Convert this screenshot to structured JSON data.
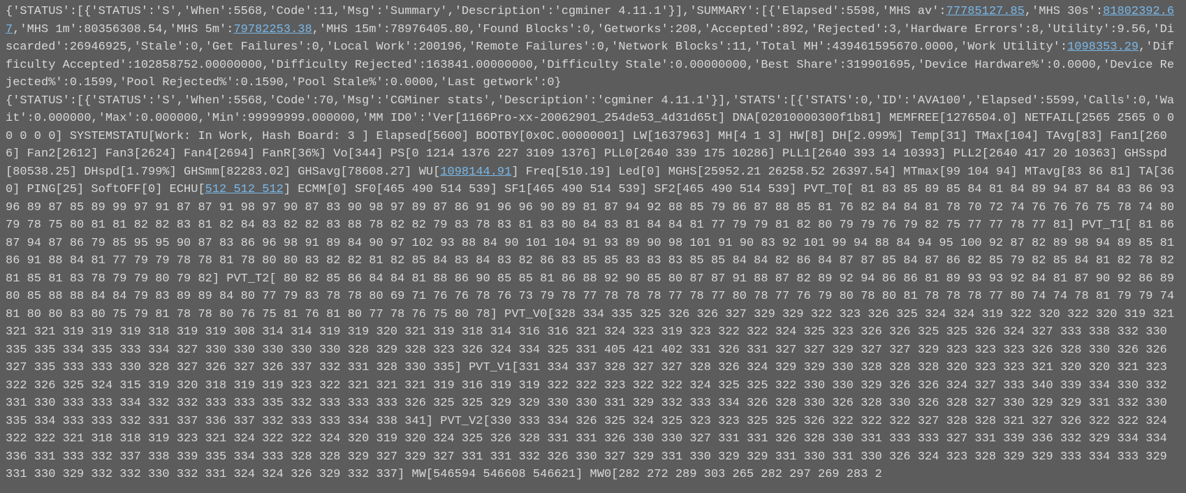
{
  "summary": {
    "status": {
      "STATUS": "S",
      "When": 5568,
      "Code": 11,
      "Msg": "Summary",
      "Description": "cgminer 4.11.1"
    },
    "data": {
      "Elapsed": 5598,
      "MHS_av": "77785127.85",
      "MHS_30s": "81802392.67",
      "MHS_1m": "80356308.54",
      "MHS_5m": "79782253.38",
      "MHS_15m": "78976405.80",
      "Found_Blocks": 0,
      "Getworks": 208,
      "Accepted": 892,
      "Rejected": 3,
      "Hardware_Errors": 8,
      "Utility": "9.56",
      "Discarded": 26946925,
      "Stale": 0,
      "Get_Failures": 0,
      "Local_Work": 200196,
      "Remote_Failures": 0,
      "Network_Blocks": 11,
      "Total_MH": "439461595670.0000",
      "Work_Utility": "1098353.29",
      "Difficulty_Accepted": "102858752.00000000",
      "Difficulty_Rejected": "163841.00000000",
      "Difficulty_Stale": "0.00000000",
      "Best_Share": 319901695,
      "Device_Hardware_pct": "0.0000",
      "Device_Rejected_pct": "0.1599",
      "Pool_Rejected_pct": "0.1590",
      "Pool_Stale_pct": "0.0000",
      "Last_getwork": 0
    }
  },
  "stats": {
    "status": {
      "STATUS": "S",
      "When": 5568,
      "Code": 70,
      "Msg": "CGMiner stats",
      "Description": "cgminer 4.11.1"
    },
    "data": {
      "STATS": 0,
      "ID": "AVA100",
      "Elapsed": 5599,
      "Calls": 0,
      "Wait": "0.000000",
      "Max": "0.000000",
      "Min": "99999999.000000",
      "MM_ID0": {
        "Ver": "1166Pro-xx-20062901_254de53_4d31d65t",
        "DNA": "02010000300f1b81",
        "MEMFREE": "1276504.0",
        "NETFAIL": "2565 2565 0 0 0 0 0 0",
        "SYSTEMSTATU": "Work: In Work, Hash Board: 3 ",
        "Elapsed": "5600",
        "BOOTBY": "0x0C.00000001",
        "LW": "1637963",
        "MH": "4 1 3",
        "HW": "8",
        "DH": "2.099%",
        "Temp": "31",
        "TMax": "104",
        "TAvg": "83",
        "Fan1": "2606",
        "Fan2": "2612",
        "Fan3": "2624",
        "Fan4": "2694",
        "FanR": "36%",
        "Vo": "344",
        "PS": "0 1214 1376 227 3109 1376",
        "PLL0": "2640 339 175 10286",
        "PLL1": "2640 393 14 10393",
        "PLL2": "2640 417 20 10363",
        "GHSspd": "80538.25",
        "DHspd": "1.799%",
        "GHSmm": "82283.02",
        "GHSavg": "78608.27",
        "WU": "1098144.91",
        "Freq": "510.19",
        "Led": "0",
        "MGHS": "25952.21 26258.52 26397.54",
        "MTmax": "99 104 94",
        "MTavg": "83 86 81",
        "TA": "360",
        "PING": "25",
        "SoftOFF": "0",
        "ECHU": "512 512 512",
        "ECMM": "0",
        "SF0": "465 490 514 539",
        "SF1": "465 490 514 539",
        "SF2": "465 490 514 539",
        "PVT_T0": " 81 83 85 89 85 84 81 84 89 94 87 84 83 86 93 96 89 87 85 89 99 97 91 87 87 91 98 97 90 87 83 90 98 97 89 87 86 91 96 96 90 89 81 87 94 92 88 85 79 86 87 88 85 81 76 82 84 84 81 78 70 72 74 76 76 76 75 78 74 80 79 78 75 80 81 81 82 82 83 81 82 84 83 82 82 83 88 78 82 82 79 83 78 83 81 83 80 84 83 81 84 84 81 77 79 79 81 82 80 79 79 76 79 82 75 77 77 78 77 81",
        "PVT_T1": " 81 86 87 94 87 86 79 85 95 95 90 87 83 86 96 98 91 89 84 90 97 102 93 88 84 90 101 104 91 93 89 90 98 101 91 90 83 92 101 99 94 88 84 94 95 100 92 87 82 89 98 94 89 85 81 86 91 88 84 81 77 79 79 78 78 81 78 80 80 83 82 82 81 82 85 84 83 84 83 82 86 83 85 85 83 83 83 85 85 84 84 82 86 84 87 87 85 84 87 86 82 85 79 82 85 84 81 82 78 82 81 85 81 83 78 79 79 80 79 82",
        "PVT_T2": " 80 82 85 86 84 84 81 88 86 90 85 85 81 86 88 92 90 85 80 87 87 91 88 87 82 89 92 94 86 86 81 89 93 93 92 84 81 87 90 92 86 89 80 85 88 88 84 84 79 83 89 89 84 80 77 79 83 78 78 80 69 71 76 76 78 76 73 79 78 77 78 78 78 77 78 77 80 78 77 76 79 80 78 80 81 78 78 78 77 80 74 74 78 81 79 79 74 81 80 80 83 80 75 79 81 78 78 80 76 75 81 76 81 80 77 78 76 75 80 78",
        "PVT_V0": "328 334 335 325 326 326 327 329 329 322 323 326 325 324 324 319 322 320 322 320 319 321 321 321 319 319 319 318 319 319 308 314 314 319 319 320 321 319 318 314 316 316 321 324 323 319 323 322 322 324 325 323 326 326 325 325 326 324 327 333 338 332 330 335 335 334 335 333 334 327 330 330 330 330 330 328 329 328 323 326 324 334 325 331 405 421 402 331 326 331 327 327 329 327 327 329 323 323 323 326 328 330 326 326 327 335 333 333 330 328 327 326 327 326 337 332 331 328 330 335",
        "PVT_V1": "331 334 337 328 327 327 328 326 324 329 329 330 328 328 328 320 323 323 321 320 320 321 323 322 326 325 324 315 319 320 318 319 319 323 322 321 321 321 319 316 319 319 322 322 323 322 322 324 325 325 322 330 330 329 326 326 324 327 333 340 339 334 330 332 331 330 333 333 334 332 332 333 333 335 332 333 333 333 326 325 325 329 329 330 330 331 329 332 333 334 326 328 330 326 328 330 326 328 327 330 329 329 331 332 330 335 334 333 333 332 331 337 336 337 332 333 333 334 338 341",
        "PVT_V2": "330 333 334 326 325 324 325 323 323 325 325 326 322 322 322 327 328 328 321 327 326 322 322 324 322 322 321 318 318 319 323 321 324 322 322 324 320 319 320 324 325 326 328 331 331 326 330 330 327 331 331 326 328 330 331 333 333 327 331 339 336 332 329 334 334 336 331 333 332 337 338 339 335 334 333 328 328 329 327 329 327 331 331 332 326 330 327 329 331 330 329 329 331 330 331 330 326 324 323 328 329 329 333 334 333 329 331 330 329 332 332 330 332 331 324 324 326 329 332 337",
        "MW": "546594 546608 546621",
        "MW0_partial": "282 272 289 303 265 282 297 269 283 2"
      }
    }
  },
  "text": {
    "s0": "{'STATUS':[{'STATUS':'S','When':5568,'Code':11,'Msg':'Summary','Description':'cgminer 4.11.1'}],'SUMMARY':[{'Elapsed':5598,'MHS av':",
    "s1": ",'MHS 30s':",
    "s2": ",'MHS 1m':80356308.54,'MHS 5m':",
    "s3": ",'MHS 15m':78976405.80,'Found Blocks':0,'Getworks':208,'Accepted':892,'Rejected':3,'Hardware Errors':8,'Utility':9.56,'Discarded':26946925,'Stale':0,'Get Failures':0,'Local Work':200196,'Remote Failures':0,'Network Blocks':11,'Total MH':439461595670.0000,'Work Utility':",
    "s4": ",'Difficulty Accepted':102858752.00000000,'Difficulty Rejected':163841.00000000,'Difficulty Stale':0.00000000,'Best Share':319901695,'Device Hardware%':0.0000,'Device Rejected%':0.1599,'Pool Rejected%':0.1590,'Pool Stale%':0.0000,'Last getwork':0}",
    "s5": "{'STATUS':[{'STATUS':'S','When':5568,'Code':70,'Msg':'CGMiner stats','Description':'cgminer 4.11.1'}],'STATS':[{'STATS':0,'ID':'AVA100','Elapsed':5599,'Calls':0,'Wait':0.000000,'Max':0.000000,'Min':99999999.000000,'MM ID0':'Ver[1166Pro-xx-20062901_254de53_4d31d65t] DNA[02010000300f1b81] MEMFREE[1276504.0] NETFAIL[2565 2565 0 0 0 0 0 0] SYSTEMSTATU[Work: In Work, Hash Board: 3 ] Elapsed[5600] BOOTBY[0x0C.00000001] LW[1637963] MH[4 1 3] HW[8] DH[2.099%] Temp[31] TMax[104] TAvg[83] Fan1[2606] Fan2[2612] Fan3[2624] Fan4[2694] FanR[36%] Vo[344] PS[0 1214 1376 227 3109 1376] PLL0[2640 339 175 10286] PLL1[2640 393 14 10393] PLL2[2640 417 20 10363] GHSspd[80538.25] DHspd[1.799%] GHSmm[82283.02] GHSavg[78608.27] WU[",
    "s6": "] Freq[510.19] Led[0] MGHS[25952.21 26258.52 26397.54] MTmax[99 104 94] MTavg[83 86 81] TA[360] PING[25] SoftOFF[0] ECHU[",
    "s7": "] ECMM[0] SF0[465 490 514 539] SF1[465 490 514 539] SF2[465 490 514 539] PVT_T0[ 81 83 85 89 85 84 81 84 89 94 87 84 83 86 93 96 89 87 85 89 99 97 91 87 87 91 98 97 90 87 83 90 98 97 89 87 86 91 96 96 90 89 81 87 94 92 88 85 79 86 87 88 85 81 76 82 84 84 81 78 70 72 74 76 76 76 75 78 74 80 79 78 75 80 81 81 82 82 83 81 82 84 83 82 82 83 88 78 82 82 79 83 78 83 81 83 80 84 83 81 84 84 81 77 79 79 81 82 80 79 79 76 79 82 75 77 77 78 77 81] PVT_T1[ 81 86 87 94 87 86 79 85 95 95 90 87 83 86 96 98 91 89 84 90 97 102 93 88 84 90 101 104 91 93 89 90 98 101 91 90 83 92 101 99 94 88 84 94 95 100 92 87 82 89 98 94 89 85 81 86 91 88 84 81 77 79 79 78 78 81 78 80 80 83 82 82 81 82 85 84 83 84 83 82 86 83 85 85 83 83 83 85 85 84 84 82 86 84 87 87 85 84 87 86 82 85 79 82 85 84 81 82 78 82 81 85 81 83 78 79 79 80 79 82] PVT_T2[ 80 82 85 86 84 84 81 88 86 90 85 85 81 86 88 92 90 85 80 87 87 91 88 87 82 89 92 94 86 86 81 89 93 93 92 84 81 87 90 92 86 89 80 85 88 88 84 84 79 83 89 89 84 80 77 79 83 78 78 80 69 71 76 76 78 76 73 79 78 77 78 78 78 77 78 77 80 78 77 76 79 80 78 80 81 78 78 78 77 80 74 74 78 81 79 79 74 81 80 80 83 80 75 79 81 78 78 80 76 75 81 76 81 80 77 78 76 75 80 78] PVT_V0[328 334 335 325 326 326 327 329 329 322 323 326 325 324 324 319 322 320 322 320 319 321 321 321 319 319 319 318 319 319 308 314 314 319 319 320 321 319 318 314 316 316 321 324 323 319 323 322 322 324 325 323 326 326 325 325 326 324 327 333 338 332 330 335 335 334 335 333 334 327 330 330 330 330 330 328 329 328 323 326 324 334 325 331 405 421 402 331 326 331 327 327 329 327 327 329 323 323 323 326 328 330 326 326 327 335 333 333 330 328 327 326 327 326 337 332 331 328 330 335] PVT_V1[331 334 337 328 327 327 328 326 324 329 329 330 328 328 328 320 323 323 321 320 320 321 323 322 326 325 324 315 319 320 318 319 319 323 322 321 321 321 319 316 319 319 322 322 323 322 322 324 325 325 322 330 330 329 326 326 324 327 333 340 339 334 330 332 331 330 333 333 334 332 332 333 333 335 332 333 333 333 326 325 325 329 329 330 330 331 329 332 333 334 326 328 330 326 328 330 326 328 327 330 329 329 331 332 330 335 334 333 333 332 331 337 336 337 332 333 333 334 338 341] PVT_V2[330 333 334 326 325 324 325 323 323 325 325 326 322 322 322 327 328 328 321 327 326 322 322 324 322 322 321 318 318 319 323 321 324 322 322 324 320 319 320 324 325 326 328 331 331 326 330 330 327 331 331 326 328 330 331 333 333 327 331 339 336 332 329 334 334 336 331 333 332 337 338 339 335 334 333 328 328 329 327 329 327 331 331 332 326 330 327 329 331 330 329 329 331 330 331 330 326 324 323 328 329 329 333 334 333 329 331 330 329 332 332 330 332 331 324 324 326 329 332 337] MW[546594 546608 546621] MW0[282 272 289 303 265 282 297 269 283 2"
  },
  "links": {
    "mhs_av": "77785127.85",
    "mhs_30s": "81802392.67",
    "mhs_5m": "79782253.38",
    "work_utility": "1098353.29",
    "wu": "1098144.91",
    "echu": "512 512 512"
  }
}
